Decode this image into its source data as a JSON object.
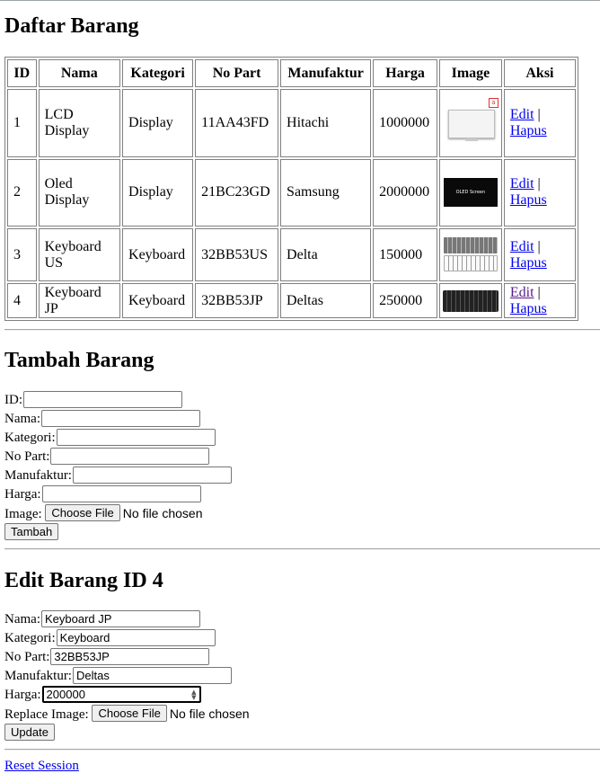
{
  "list": {
    "title": "Daftar Barang",
    "columns": [
      "ID",
      "Nama",
      "Kategori",
      "No Part",
      "Manufaktur",
      "Harga",
      "Image",
      "Aksi"
    ],
    "rows": [
      {
        "id": "1",
        "nama": "LCD Display",
        "kategori": "Display",
        "no_part": "11AA43FD",
        "manufaktur": "Hitachi",
        "harga": "1000000",
        "image_icon": "lcd-panel-image",
        "edit": "Edit",
        "sep": "|",
        "hapus": "Hapus"
      },
      {
        "id": "2",
        "nama": "Oled Display",
        "kategori": "Display",
        "no_part": "21BC23GD",
        "manufaktur": "Samsung",
        "harga": "2000000",
        "image_icon": "oled-screen-image",
        "image_caption": "OLED Screen",
        "edit": "Edit",
        "sep": "|",
        "hapus": "Hapus"
      },
      {
        "id": "3",
        "nama": "Keyboard US",
        "kategori": "Keyboard",
        "no_part": "32BB53US",
        "manufaktur": "Delta",
        "harga": "150000",
        "image_icon": "keyboard-us-image",
        "edit": "Edit",
        "sep": "|",
        "hapus": "Hapus"
      },
      {
        "id": "4",
        "nama": "Keyboard JP",
        "kategori": "Keyboard",
        "no_part": "32BB53JP",
        "manufaktur": "Deltas",
        "harga": "250000",
        "image_icon": "keyboard-jp-image",
        "edit": "Edit",
        "sep": "|",
        "hapus": "Hapus"
      }
    ],
    "colors": {
      "link": "#0000ee",
      "visited_link": "#551a8b"
    }
  },
  "add": {
    "title": "Tambah Barang",
    "id_label": "ID:",
    "nama_label": "Nama:",
    "kategori_label": "Kategori:",
    "no_part_label": "No Part:",
    "manufaktur_label": "Manufaktur:",
    "harga_label": "Harga:",
    "image_label": "Image:",
    "choose_file": "Choose File",
    "no_file": "No file chosen",
    "submit": "Tambah"
  },
  "edit": {
    "title": "Edit Barang ID 4",
    "nama_label": "Nama:",
    "nama_value": "Keyboard JP",
    "kategori_label": "Kategori:",
    "kategori_value": "Keyboard",
    "no_part_label": "No Part:",
    "no_part_value": "32BB53JP",
    "manufaktur_label": "Manufaktur:",
    "manufaktur_value": "Deltas",
    "harga_label": "Harga:",
    "harga_value": "200000",
    "image_label": "Replace Image:",
    "choose_file": "Choose File",
    "no_file": "No file chosen",
    "submit": "Update"
  },
  "reset_link": "Reset Session"
}
